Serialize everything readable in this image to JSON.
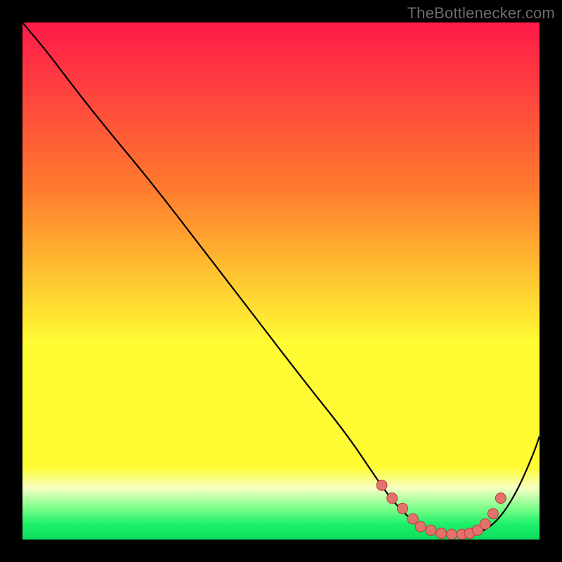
{
  "attribution": "TheBottlenecker.com",
  "gradient": {
    "top": "#ff1a4a",
    "mid1": "#ff7a2e",
    "mid2": "#fffc33",
    "band_pale": "#f7ffc2",
    "band_green1": "#7bff8a",
    "band_green2": "#1ff06a",
    "bottom": "#0bdc5e"
  },
  "curve_color": "#000000",
  "marker_fill": "#e2736c",
  "marker_stroke": "#bd3b3b",
  "chart_data": {
    "type": "line",
    "title": "",
    "xlabel": "",
    "ylabel": "",
    "xlim": [
      0,
      100
    ],
    "ylim": [
      0,
      100
    ],
    "series": [
      {
        "name": "curve",
        "x": [
          0,
          5,
          8,
          15,
          25,
          35,
          45,
          55,
          63,
          69,
          72,
          76,
          80,
          84,
          87,
          90,
          93,
          96,
          99,
          100
        ],
        "y": [
          100,
          94,
          90,
          81,
          69,
          56,
          43,
          30,
          20,
          11,
          7,
          3,
          1.5,
          1,
          1,
          2,
          5,
          10,
          17,
          20
        ]
      }
    ],
    "markers": {
      "name": "beads",
      "x": [
        69.5,
        71.5,
        73.5,
        75.5,
        77.0,
        79.0,
        81.0,
        83.0,
        85.0,
        86.5,
        88.0,
        89.5,
        91.0,
        92.5
      ],
      "y": [
        10.5,
        8.0,
        6.0,
        4.0,
        2.5,
        1.8,
        1.2,
        1.0,
        1.0,
        1.2,
        1.8,
        3.0,
        5.0,
        8.0
      ]
    }
  }
}
